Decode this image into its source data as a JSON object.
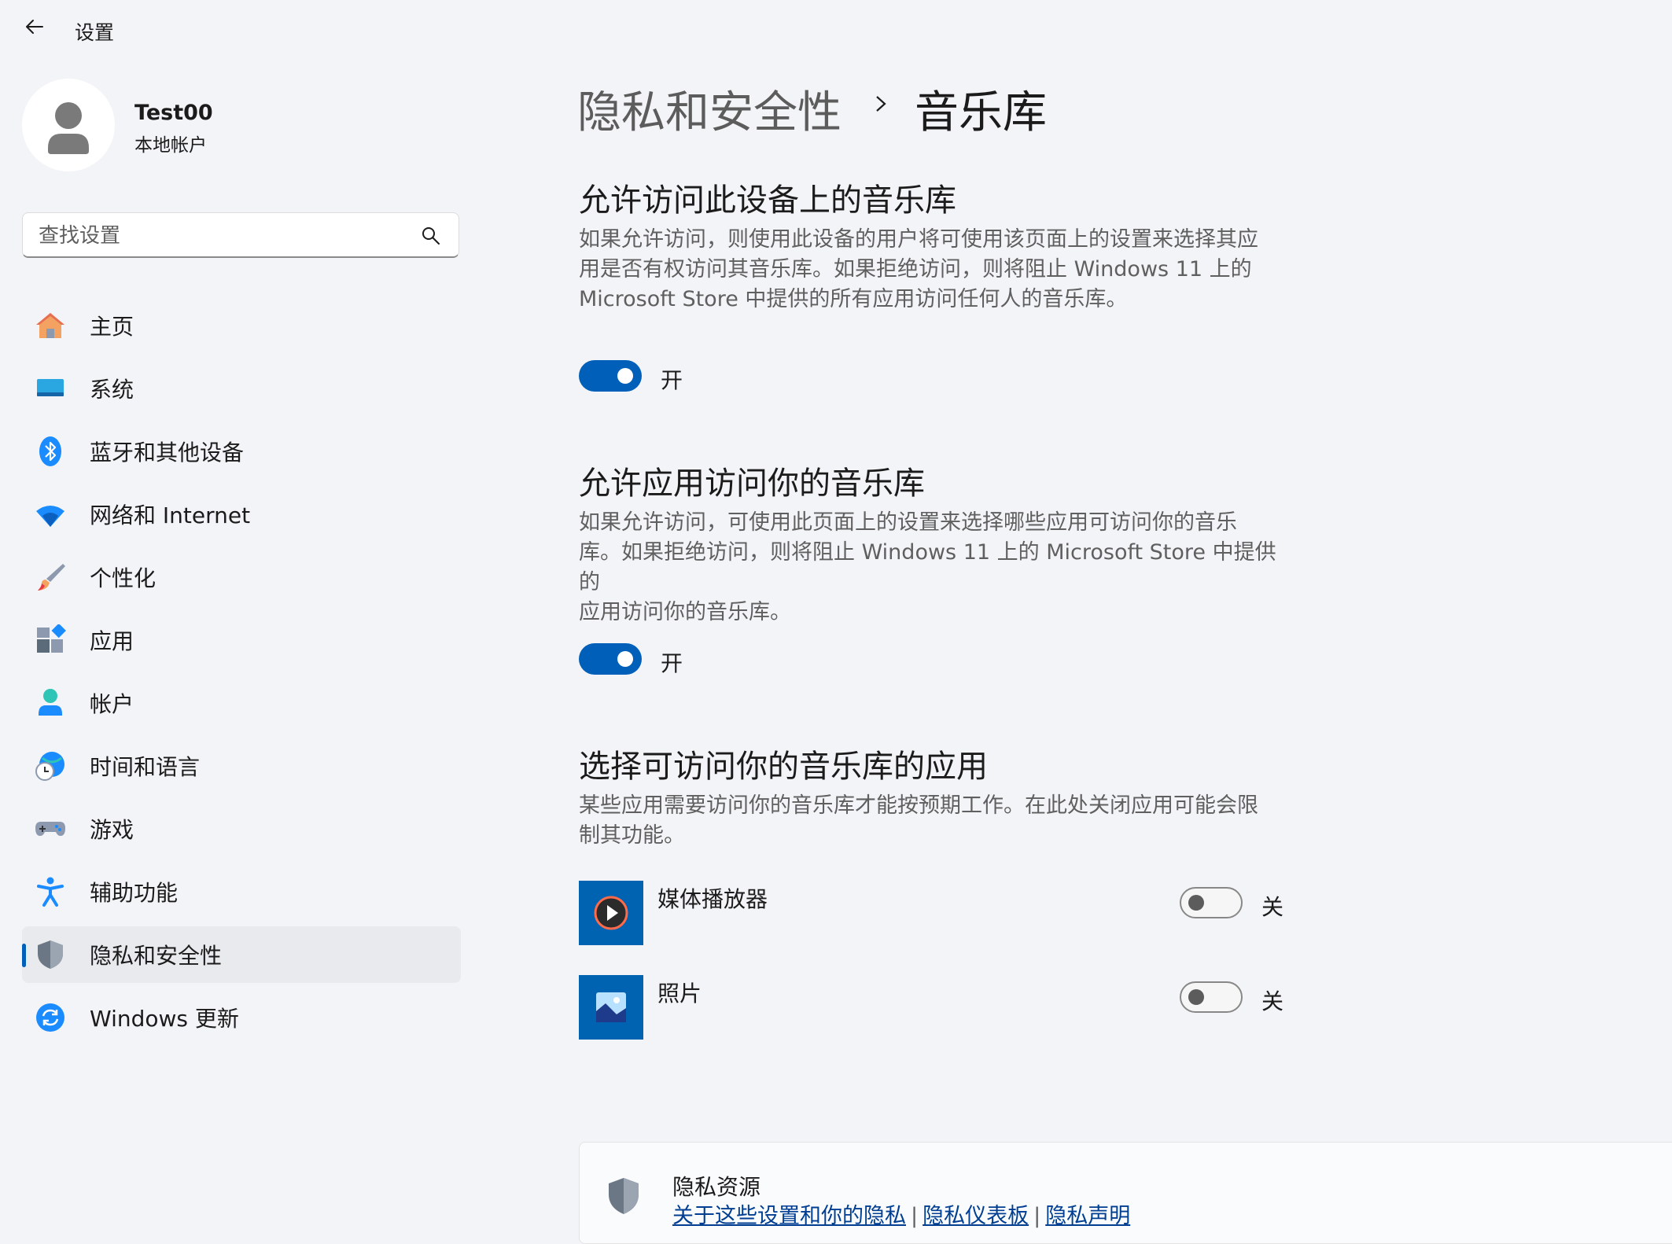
{
  "app": {
    "title": "设置"
  },
  "user": {
    "name": "Test00",
    "account_type": "本地帐户"
  },
  "search": {
    "placeholder": "查找设置"
  },
  "sidebar": {
    "items": [
      {
        "label": "主页",
        "icon": "home-icon"
      },
      {
        "label": "系统",
        "icon": "system-icon"
      },
      {
        "label": "蓝牙和其他设备",
        "icon": "bluetooth-icon"
      },
      {
        "label": "网络和 Internet",
        "icon": "wifi-icon"
      },
      {
        "label": "个性化",
        "icon": "brush-icon"
      },
      {
        "label": "应用",
        "icon": "apps-icon"
      },
      {
        "label": "帐户",
        "icon": "account-icon"
      },
      {
        "label": "时间和语言",
        "icon": "time-language-icon"
      },
      {
        "label": "游戏",
        "icon": "gamepad-icon"
      },
      {
        "label": "辅助功能",
        "icon": "accessibility-icon"
      },
      {
        "label": "隐私和安全性",
        "icon": "shield-icon",
        "active": true
      },
      {
        "label": "Windows 更新",
        "icon": "update-icon"
      }
    ]
  },
  "breadcrumb": {
    "parent": "隐私和安全性",
    "current": "音乐库"
  },
  "sections": {
    "device_access": {
      "title": "允许访问此设备上的音乐库",
      "desc_lines": [
        "如果允许访问，则使用此设备的用户将可使用该页面上的设置来选择其应",
        "用是否有权访问其音乐库。如果拒绝访问，则将阻止 Windows 11 上的",
        "Microsoft Store 中提供的所有应用访问任何人的音乐库。"
      ],
      "toggle_state": "开"
    },
    "app_access": {
      "title": "允许应用访问你的音乐库",
      "desc_lines": [
        "如果允许访问，可使用此页面上的设置来选择哪些应用可访问你的音乐",
        "库。如果拒绝访问，则将阻止 Windows 11 上的 Microsoft Store 中提供的",
        "应用访问你的音乐库。"
      ],
      "toggle_state": "开"
    },
    "choose_apps": {
      "title": "选择可访问你的音乐库的应用",
      "desc_lines": [
        "某些应用需要访问你的音乐库才能按预期工作。在此处关闭应用可能会限",
        "制其功能。"
      ],
      "apps": [
        {
          "name": "媒体播放器",
          "icon": "media-player-icon",
          "toggle_state": "关"
        },
        {
          "name": "照片",
          "icon": "photos-icon",
          "toggle_state": "关"
        }
      ]
    }
  },
  "resources": {
    "title": "隐私资源",
    "links": [
      "关于这些设置和你的隐私",
      "隐私仪表板",
      "隐私声明"
    ]
  },
  "colors": {
    "accent": "#005fb8",
    "background": "#f3f4f7"
  }
}
